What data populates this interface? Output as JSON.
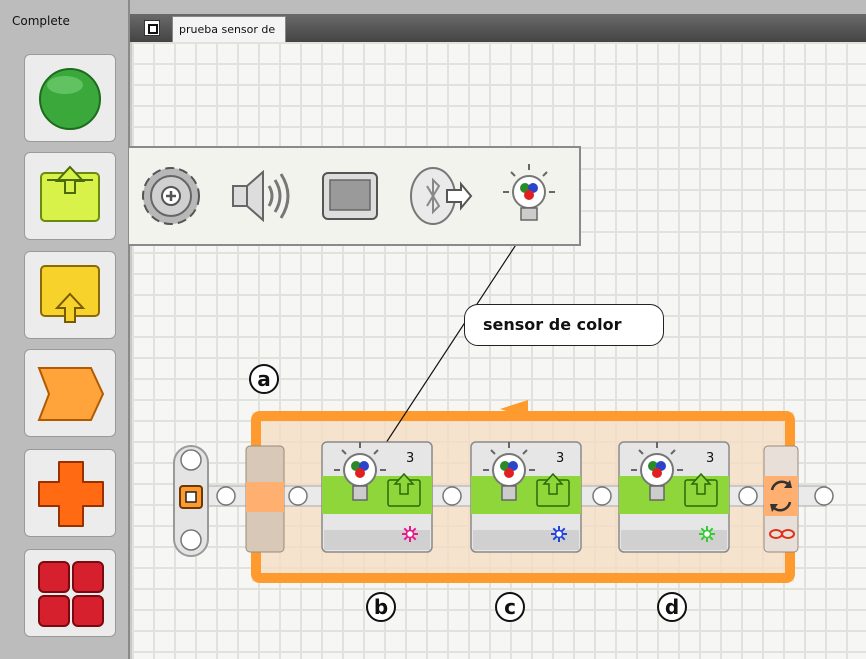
{
  "palette": {
    "tab_label": "Complete",
    "items": [
      {
        "name": "common-blocks",
        "icon": "green-circle-icon",
        "color": "#3aa83a"
      },
      {
        "name": "action-blocks",
        "icon": "lime-upload-icon",
        "color": "#d8f24a"
      },
      {
        "name": "sensor-blocks",
        "icon": "yellow-upload-icon",
        "color": "#f6d22a"
      },
      {
        "name": "flow-blocks",
        "icon": "orange-chevron-icon",
        "color": "#ffa43a"
      },
      {
        "name": "data-blocks",
        "icon": "orange-cross-icon",
        "color": "#ff6a12"
      },
      {
        "name": "advanced-blocks",
        "icon": "red-grid-icon",
        "color": "#d6202e"
      }
    ]
  },
  "document": {
    "tab_label": "prueba sensor de"
  },
  "popup": {
    "icons": [
      "motor-gear-icon",
      "speaker-icon",
      "display-icon",
      "bluetooth-send-icon",
      "color-lamp-icon"
    ]
  },
  "callout": {
    "text": "sensor de color"
  },
  "annotations": {
    "a": "a",
    "b": "b",
    "c": "c",
    "d": "d"
  },
  "blocks": [
    {
      "port": "3",
      "lamp_color": "#e8198a"
    },
    {
      "port": "3",
      "lamp_color": "#2244dd"
    },
    {
      "port": "3",
      "lamp_color": "#33cc33"
    }
  ],
  "loop": {
    "mode_icon": "infinity-icon"
  }
}
